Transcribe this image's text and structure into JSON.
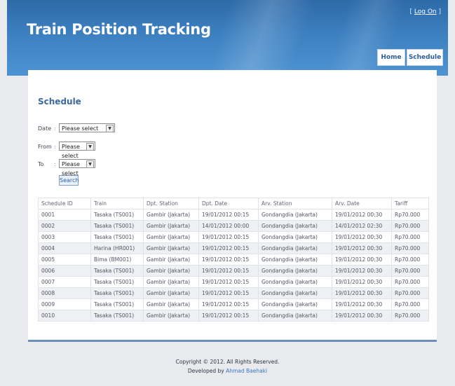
{
  "header": {
    "title": "Train Position Tracking",
    "logon": "Log On",
    "nav": {
      "home": "Home",
      "schedule": "Schedule"
    }
  },
  "page": {
    "heading": "Schedule"
  },
  "form": {
    "date_label": "Date",
    "from_label": "From",
    "to_label": "To",
    "colon": ":",
    "date_value": "Please select",
    "from_value": "Please select",
    "to_value": "Please select",
    "search_label": "Search"
  },
  "table": {
    "headers": [
      "Schedule ID",
      "Train",
      "Dpt. Station",
      "Dpt. Date",
      "Arv. Station",
      "Arv. Date",
      "Tariff"
    ],
    "rows": [
      [
        "0001",
        "Tasaka (TS001)",
        "Gambir (Jakarta)",
        "19/01/2012 00:15",
        "Gondangdia (Jakarta)",
        "19/01/2012 00:30",
        "Rp70.000"
      ],
      [
        "0002",
        "Tasaka (TS001)",
        "Gambir (Jakarta)",
        "14/01/2012 00:00",
        "Gondangdia (Jakarta)",
        "14/01/2012 02:30",
        "Rp70.000"
      ],
      [
        "0003",
        "Tasaka (TS001)",
        "Gambir (Jakarta)",
        "19/01/2012 00:15",
        "Gondangdia (Jakarta)",
        "19/01/2012 00:30",
        "Rp70.000"
      ],
      [
        "0004",
        "Harina (HR001)",
        "Gambir (Jakarta)",
        "19/01/2012 00:15",
        "Gondangdia (Jakarta)",
        "19/01/2012 00:30",
        "Rp70.000"
      ],
      [
        "0005",
        "Bima (BM001)",
        "Gambir (Jakarta)",
        "19/01/2012 00:15",
        "Gondangdia (Jakarta)",
        "19/01/2012 00:30",
        "Rp70.000"
      ],
      [
        "0006",
        "Tasaka (TS001)",
        "Gambir (Jakarta)",
        "19/01/2012 00:15",
        "Gondangdia (Jakarta)",
        "19/01/2012 00:30",
        "Rp70.000"
      ],
      [
        "0007",
        "Tasaka (TS001)",
        "Gambir (Jakarta)",
        "19/01/2012 00:15",
        "Gondangdia (Jakarta)",
        "19/01/2012 00:30",
        "Rp70.000"
      ],
      [
        "0008",
        "Tasaka (TS001)",
        "Gambir (Jakarta)",
        "19/01/2012 00:15",
        "Gondangdia (Jakarta)",
        "19/01/2012 00:30",
        "Rp70.000"
      ],
      [
        "0009",
        "Tasaka (TS001)",
        "Gambir (Jakarta)",
        "19/01/2012 00:15",
        "Gondangdia (Jakarta)",
        "19/01/2012 00:30",
        "Rp70.000"
      ],
      [
        "0010",
        "Tasaka (TS001)",
        "Gambir (Jakarta)",
        "19/01/2012 00:15",
        "Gondangdia (Jakarta)",
        "19/01/2012 00:30",
        "Rp70.000"
      ]
    ]
  },
  "footer": {
    "copyright": "Copyright © 2012. All Rights Reserved.",
    "developed_by": "Developed by",
    "author": "Ahmad Baehaki"
  },
  "colors": {
    "header_blue": "#3d80c1",
    "accent": "#3b6aa0",
    "link": "#3a78c2"
  },
  "icons": {
    "dropdown": "chevron-down-icon"
  }
}
